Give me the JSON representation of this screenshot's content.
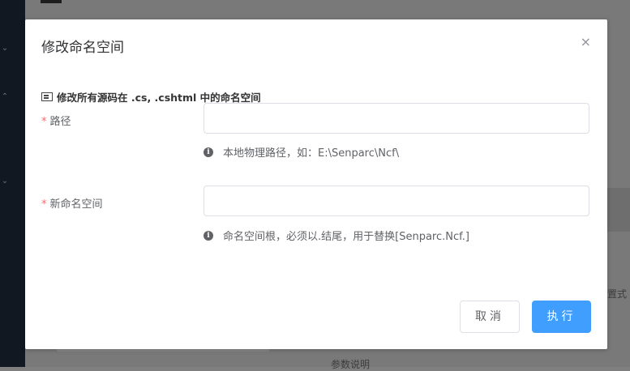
{
  "modal": {
    "title": "修改命名空间",
    "close_icon": "×",
    "section_title": "修改所有源码在 .cs, .cshtml 中的命名空间",
    "fields": [
      {
        "label": "路径",
        "required_mark": "*",
        "value": "",
        "hint": "本地物理路径，如：E:\\Senparc\\Ncf\\"
      },
      {
        "label": "新命名空间",
        "required_mark": "*",
        "value": "",
        "hint": "命名空间根，必须以.结尾，用于替换[Senparc.Ncf.]"
      }
    ],
    "cancel_label": "取消",
    "submit_label": "执行"
  },
  "background": {
    "fragment_right": "置式",
    "fragment_bottom": "参数说明"
  },
  "colors": {
    "primary": "#409eff",
    "required": "#f56c6c",
    "overlay": "#7f7f7f",
    "sidebar": "#121821"
  }
}
